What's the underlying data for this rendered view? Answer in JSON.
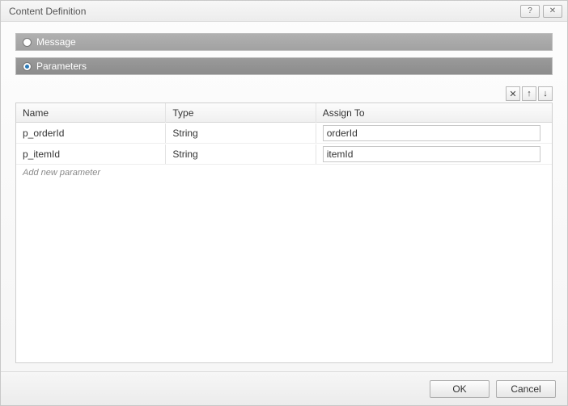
{
  "window": {
    "title": "Content Definition"
  },
  "options": {
    "message_label": "Message",
    "parameters_label": "Parameters",
    "selected": "parameters"
  },
  "toolbar": {
    "delete_tip": "✕",
    "up_tip": "↑",
    "down_tip": "↓"
  },
  "table": {
    "headers": {
      "name": "Name",
      "type": "Type",
      "assign": "Assign To"
    },
    "rows": [
      {
        "name": "p_orderId",
        "type": "String",
        "assign": "orderId"
      },
      {
        "name": "p_itemId",
        "type": "String",
        "assign": "itemId"
      }
    ],
    "add_placeholder": "Add new parameter"
  },
  "buttons": {
    "ok": "OK",
    "cancel": "Cancel"
  }
}
